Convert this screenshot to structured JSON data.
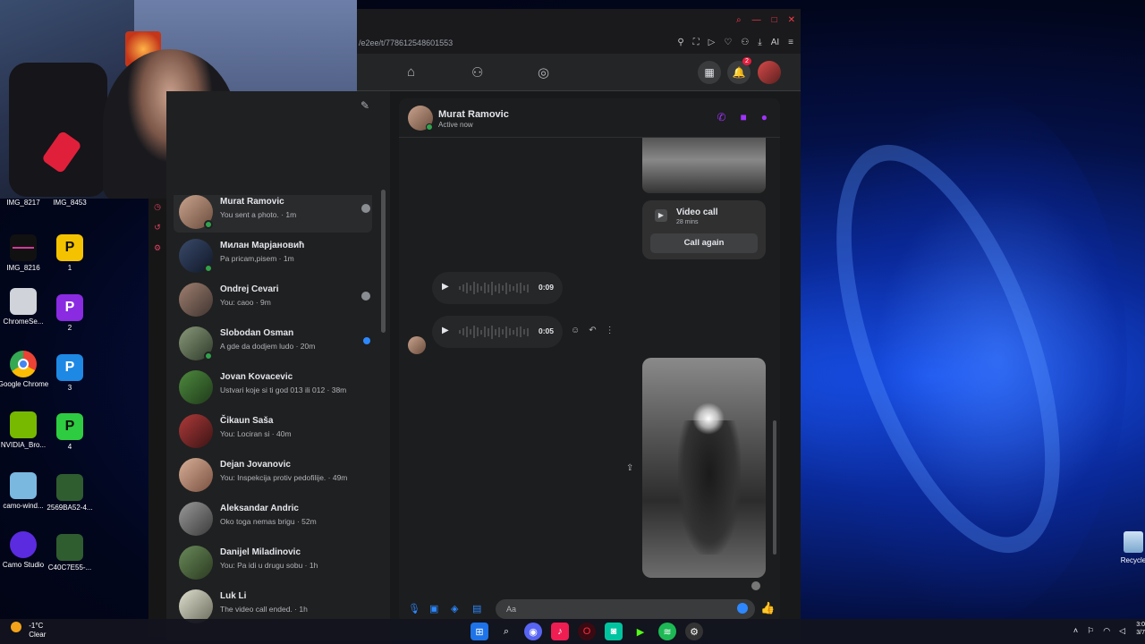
{
  "browser": {
    "address": "/e2ee/t/778612548601553",
    "ai_label": "AI",
    "notification_count": "2"
  },
  "desktop": {
    "icons": [
      {
        "label": "IMG_8217"
      },
      {
        "label": "IMG_8453"
      },
      {
        "label": "IMG_8216"
      },
      {
        "label": "1",
        "tile": "P"
      },
      {
        "label": "ChromeSe..."
      },
      {
        "label": "2",
        "tile": "P"
      },
      {
        "label": "Google Chrome"
      },
      {
        "label": "3",
        "tile": "P"
      },
      {
        "label": "NVIDIA_Bro..."
      },
      {
        "label": "4",
        "tile": "P"
      },
      {
        "label": "camo-wind..."
      },
      {
        "label": "2569BA52-4..."
      },
      {
        "label": "Camo Studio"
      },
      {
        "label": "C40C7E55-..."
      }
    ],
    "recycle_label": "Recycle"
  },
  "conversation": {
    "name": "Murat Ramovic",
    "status": "Active now",
    "call_card": {
      "title": "Video call",
      "duration": "28 mins",
      "button": "Call again"
    },
    "voice_messages": [
      {
        "duration": "0:09"
      },
      {
        "duration": "0:05"
      }
    ],
    "composer_placeholder": "Aa"
  },
  "chats": [
    {
      "name": "Murat Ramovic",
      "preview": "You sent a photo. · 1m",
      "online": true,
      "seen": true,
      "active": true
    },
    {
      "name": "Милан Марјановић",
      "preview": "Pa pricam,pisem · 1m",
      "online": true
    },
    {
      "name": "Ondrej Cevari",
      "preview": "You: caoo · 9m",
      "seen": true
    },
    {
      "name": "Slobodan Osman",
      "preview": "A gde da dodjem ludo · 20m",
      "online": true,
      "unread": true
    },
    {
      "name": "Jovan Kovacevic",
      "preview": "Ustvari koje si ti god 013 ili 012 · 38m"
    },
    {
      "name": "Čikaun Saša",
      "preview": "You: Lociran si · 40m"
    },
    {
      "name": "Dejan Jovanovic",
      "preview": "You: Inspekcija protiv pedofilije. · 49m"
    },
    {
      "name": "Aleksandar Andric",
      "preview": "Oko togа nemas brigu · 52m"
    },
    {
      "name": "Danijel Miladinovic",
      "preview": "You: Pa idi u drugu sobu · 1h"
    },
    {
      "name": "Luk Li",
      "preview": "The video call ended. · 1h"
    }
  ],
  "taskbar": {
    "weather_temp": "-1°C",
    "weather_desc": "Clear",
    "time": "3:0",
    "date": "3/7"
  }
}
